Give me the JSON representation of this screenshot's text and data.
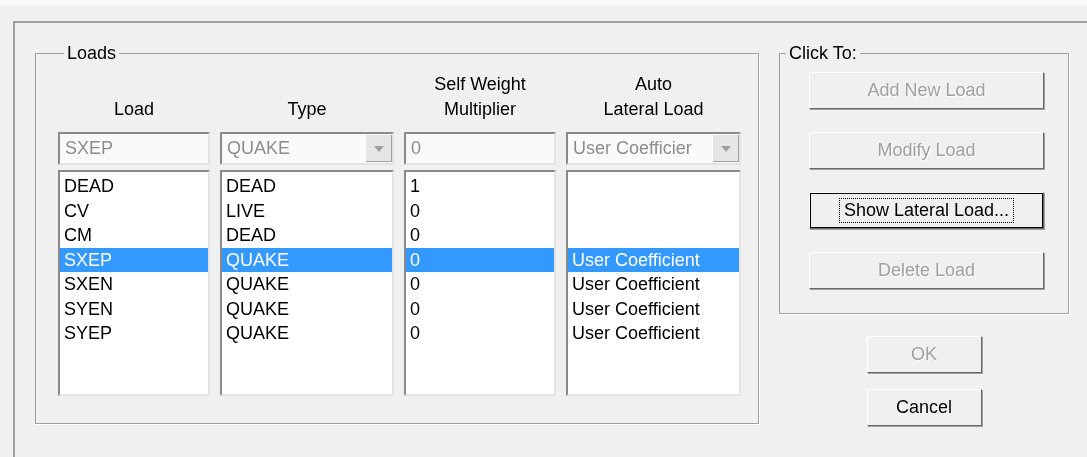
{
  "loads_group": {
    "title": "Loads",
    "columns": [
      {
        "heading": [
          "Load"
        ],
        "field": {
          "kind": "text",
          "value": "SXEP",
          "disabled": true
        }
      },
      {
        "heading": [
          "Type"
        ],
        "field": {
          "kind": "combo",
          "value": "QUAKE",
          "disabled": true
        }
      },
      {
        "heading": [
          "Self Weight",
          "Multiplier"
        ],
        "field": {
          "kind": "text",
          "value": "0",
          "disabled": true
        }
      },
      {
        "heading": [
          "Auto",
          "Lateral Load"
        ],
        "field": {
          "kind": "combo",
          "value": "User Coefficier",
          "disabled": true
        }
      }
    ],
    "rows": [
      {
        "cells": [
          "DEAD",
          "DEAD",
          "1"
        ],
        "selected": false
      },
      {
        "cells": [
          "CV",
          "LIVE",
          "0"
        ],
        "selected": false
      },
      {
        "cells": [
          "CM",
          "DEAD",
          "0"
        ],
        "selected": false
      },
      {
        "cells": [
          "SXEP",
          "QUAKE",
          "0",
          "User Coefficient"
        ],
        "selected": true
      },
      {
        "cells": [
          "SXEN",
          "QUAKE",
          "0",
          "User Coefficient"
        ],
        "selected": false
      },
      {
        "cells": [
          "SYEN",
          "QUAKE",
          "0",
          "User Coefficient"
        ],
        "selected": false
      },
      {
        "cells": [
          "SYEP",
          "QUAKE",
          "0",
          "User Coefficient"
        ],
        "selected": false
      }
    ]
  },
  "actions_group": {
    "title": "Click To:",
    "buttons": [
      {
        "label": "Add New Load",
        "disabled": true,
        "focused": false
      },
      {
        "label": "Modify Load",
        "disabled": true,
        "focused": false
      },
      {
        "label": "Show Lateral Load...",
        "disabled": false,
        "focused": true
      },
      {
        "label": "Delete Load",
        "disabled": true,
        "focused": false
      }
    ]
  },
  "dialog_buttons": [
    {
      "label": "OK",
      "disabled": true,
      "focused": false
    },
    {
      "label": "Cancel",
      "disabled": false,
      "focused": false
    }
  ]
}
